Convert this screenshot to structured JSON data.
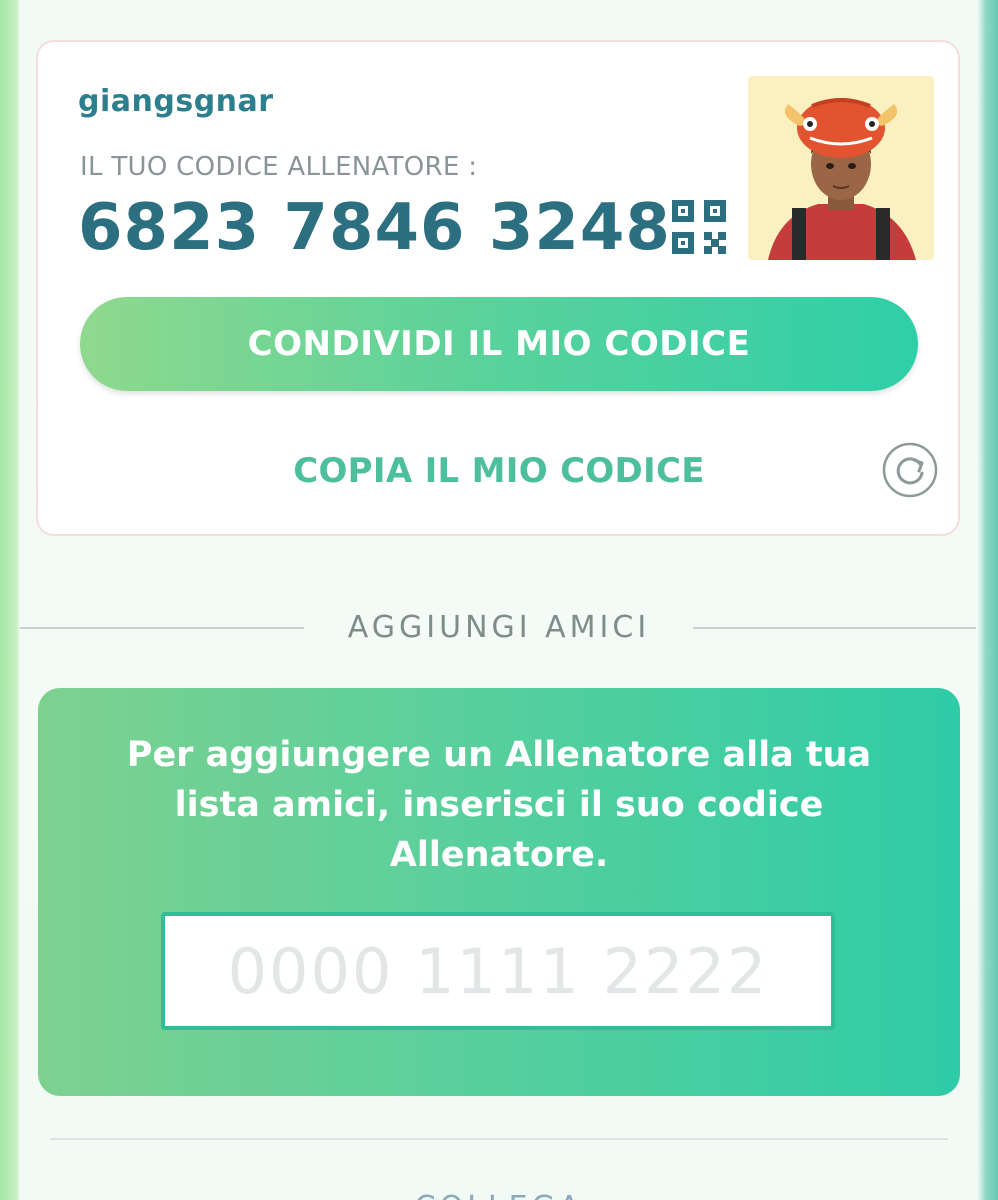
{
  "trainer": {
    "username": "giangsgnar",
    "code_label": "IL TUO CODICE ALLENATORE :",
    "code": "6823 7846 3248",
    "share_label": "CONDIVIDI IL MIO CODICE",
    "copy_label": "COPIA IL MIO CODICE",
    "icons": [
      "qr-code-icon",
      "refresh-icon",
      "trainer-avatar"
    ]
  },
  "add_friends": {
    "section_title": "AGGIUNGI AMICI",
    "instructions": "Per aggiungere un Allenatore alla tua lista amici, inserisci il suo codice Allenatore.",
    "input_placeholder": "0000 1111 2222",
    "input_value": ""
  },
  "next_section": {
    "title": "COLLEGA"
  },
  "colors": {
    "accent_teal": "#2b6f80",
    "button_gradient_start": "#8fd98e",
    "button_gradient_end": "#2ecfa8",
    "copy_green": "#4ebf9d"
  }
}
